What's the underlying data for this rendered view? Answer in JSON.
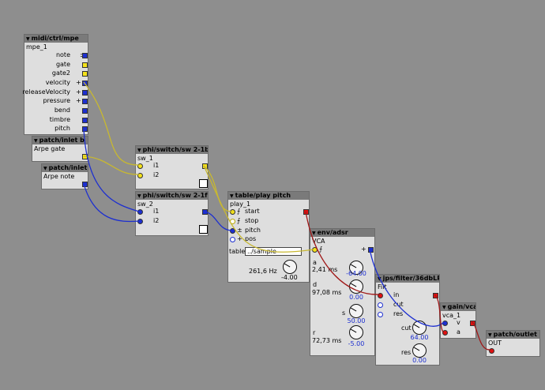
{
  "objects": {
    "mpe": {
      "type": "midi/ctrl/mpe",
      "name": "mpe_1",
      "outlets": [
        {
          "label": "note",
          "sym": "±"
        },
        {
          "label": "gate",
          "sym": ""
        },
        {
          "label": "gate2",
          "sym": ""
        },
        {
          "label": "velocity",
          "sym": "+"
        },
        {
          "label": "releaseVelocity",
          "sym": "+"
        },
        {
          "label": "pressure",
          "sym": "+"
        },
        {
          "label": "bend",
          "sym": ""
        },
        {
          "label": "timbre",
          "sym": ""
        },
        {
          "label": "pitch",
          "sym": ""
        }
      ]
    },
    "inlet_b": {
      "type": "patch/inlet b",
      "name": "Arpe gate"
    },
    "inlet_f": {
      "type": "patch/inlet f",
      "name": "Arpe note"
    },
    "sw1": {
      "type": "phi/switch/sw 2-1b",
      "name": "sw_1",
      "in1": "i1",
      "in2": "i2"
    },
    "sw2": {
      "type": "phi/switch/sw 2-1f",
      "name": "sw_2",
      "in1": "i1",
      "in2": "i2"
    },
    "play": {
      "type": "table/play pitch",
      "name": "play_1",
      "inlets": [
        {
          "label": "start",
          "sym": "⨍"
        },
        {
          "label": "stop",
          "sym": "⨍"
        },
        {
          "label": "pitch",
          "sym": "±"
        },
        {
          "label": "pos",
          "sym": "+"
        }
      ],
      "table_label": "table",
      "table_value": "../sample",
      "freq": "261,6 Hz",
      "knob_value": "-4.00"
    },
    "adsr": {
      "type": "env/adsr",
      "name": "VCA",
      "gate_sym": "⨍",
      "out_sym": "+",
      "a_label": "a",
      "a_time": "2,41 ms",
      "a_value": "-64.00",
      "d_label": "d",
      "d_time": "97,08 ms",
      "d_value": "0.00",
      "s_label": "s",
      "s_value": "50.00",
      "r_label": "r",
      "r_time": "72,73 ms",
      "r_value": "-5.00"
    },
    "filt": {
      "type": "jps/filter/36dbLP",
      "name": "Filt",
      "inlets": [
        "in",
        "cut",
        "res"
      ],
      "cut_label": "cut",
      "cut_value": "64.00",
      "res_label": "res",
      "res_value": "0.00"
    },
    "vca": {
      "type": "gain/vca",
      "name": "vca_1",
      "in1": "v",
      "in2": "a"
    },
    "outlet": {
      "type": "patch/outlet a",
      "name": "OUT"
    }
  },
  "colors": {
    "background": "#8e8e8e",
    "object": "#dedede",
    "header": "#7a7a7a",
    "frac": "#1d2fd0",
    "bool": "#f4e21a",
    "audio": "#e01010",
    "wire_frac": "#1d2fd0",
    "wire_bool": "#c8b830",
    "wire_audio": "#a01818"
  }
}
